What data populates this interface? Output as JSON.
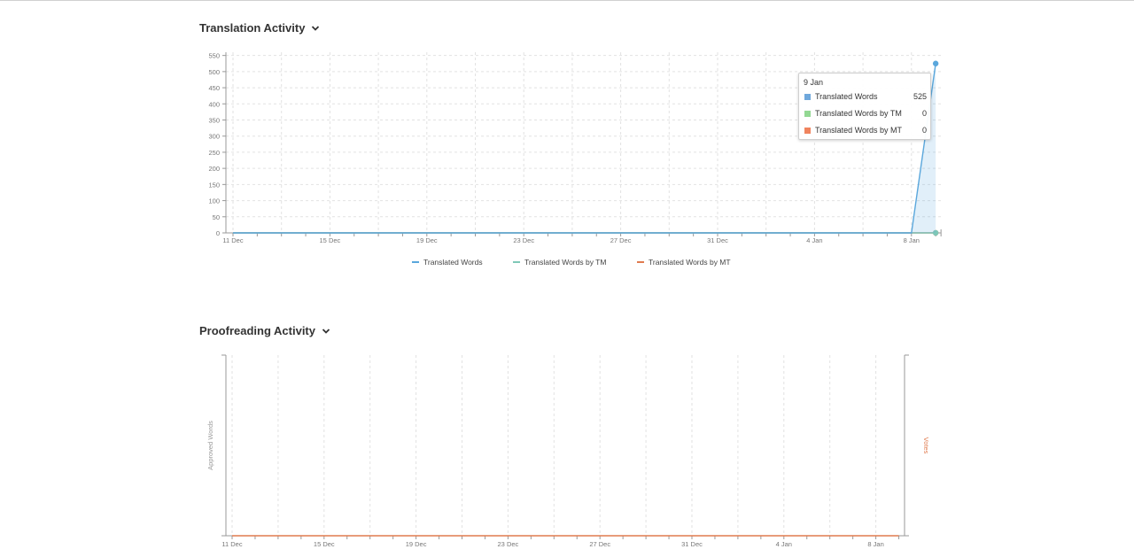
{
  "translation": {
    "title": "Translation Activity",
    "tooltip": {
      "date": "9 Jan",
      "rows": [
        {
          "label": "Translated Words",
          "value": "525",
          "color": "#6fa8dc"
        },
        {
          "label": "Translated Words by TM",
          "value": "0",
          "color": "#93d893"
        },
        {
          "label": "Translated Words by MT",
          "value": "0",
          "color": "#f0845e"
        }
      ]
    }
  },
  "proofreading": {
    "title": "Proofreading Activity"
  },
  "chart_data": [
    {
      "type": "line",
      "title": "Translation Activity",
      "x": [
        "11 Dec",
        "12 Dec",
        "13 Dec",
        "14 Dec",
        "15 Dec",
        "16 Dec",
        "17 Dec",
        "18 Dec",
        "19 Dec",
        "20 Dec",
        "21 Dec",
        "22 Dec",
        "23 Dec",
        "24 Dec",
        "25 Dec",
        "26 Dec",
        "27 Dec",
        "28 Dec",
        "29 Dec",
        "30 Dec",
        "31 Dec",
        "1 Jan",
        "2 Jan",
        "3 Jan",
        "4 Jan",
        "5 Jan",
        "6 Jan",
        "7 Jan",
        "8 Jan",
        "9 Jan"
      ],
      "x_tick_labels": [
        "11 Dec",
        "15 Dec",
        "19 Dec",
        "23 Dec",
        "27 Dec",
        "31 Dec",
        "4 Jan",
        "8 Jan"
      ],
      "y_tick_labels": [
        "0",
        "50",
        "100",
        "150",
        "200",
        "250",
        "300",
        "350",
        "400",
        "450",
        "500",
        "550"
      ],
      "ylim": [
        0,
        560
      ],
      "grid": true,
      "legend_position": "bottom",
      "series": [
        {
          "name": "Translated Words",
          "color": "#5aa7dc",
          "values": [
            0,
            0,
            0,
            0,
            0,
            0,
            0,
            0,
            0,
            0,
            0,
            0,
            0,
            0,
            0,
            0,
            0,
            0,
            0,
            0,
            0,
            0,
            0,
            0,
            0,
            0,
            0,
            0,
            0,
            525
          ]
        },
        {
          "name": "Translated Words by TM",
          "color": "#7fc8b8",
          "values": [
            0,
            0,
            0,
            0,
            0,
            0,
            0,
            0,
            0,
            0,
            0,
            0,
            0,
            0,
            0,
            0,
            0,
            0,
            0,
            0,
            0,
            0,
            0,
            0,
            0,
            0,
            0,
            0,
            0,
            0
          ]
        },
        {
          "name": "Translated Words by MT",
          "color": "#e07b4f",
          "values": [
            0,
            0,
            0,
            0,
            0,
            0,
            0,
            0,
            0,
            0,
            0,
            0,
            0,
            0,
            0,
            0,
            0,
            0,
            0,
            0,
            0,
            0,
            0,
            0,
            0,
            0,
            0,
            0,
            0,
            0
          ]
        }
      ]
    },
    {
      "type": "line",
      "title": "Proofreading Activity",
      "x": [
        "11 Dec",
        "12 Dec",
        "13 Dec",
        "14 Dec",
        "15 Dec",
        "16 Dec",
        "17 Dec",
        "18 Dec",
        "19 Dec",
        "20 Dec",
        "21 Dec",
        "22 Dec",
        "23 Dec",
        "24 Dec",
        "25 Dec",
        "26 Dec",
        "27 Dec",
        "28 Dec",
        "29 Dec",
        "30 Dec",
        "31 Dec",
        "1 Jan",
        "2 Jan",
        "3 Jan",
        "4 Jan",
        "5 Jan",
        "6 Jan",
        "7 Jan",
        "8 Jan",
        "9 Jan"
      ],
      "x_tick_labels": [
        "11 Dec",
        "15 Dec",
        "19 Dec",
        "23 Dec",
        "27 Dec",
        "31 Dec",
        "4 Jan",
        "8 Jan"
      ],
      "ylabel": "Approved Words",
      "y2label": "Votes",
      "ylabel_color": "#999999",
      "y2label_color": "#e07b4f",
      "grid": true,
      "series": [
        {
          "color": "#e07b4f",
          "values": [
            0,
            0,
            0,
            0,
            0,
            0,
            0,
            0,
            0,
            0,
            0,
            0,
            0,
            0,
            0,
            0,
            0,
            0,
            0,
            0,
            0,
            0,
            0,
            0,
            0,
            0,
            0,
            0,
            0,
            0
          ]
        }
      ]
    }
  ]
}
